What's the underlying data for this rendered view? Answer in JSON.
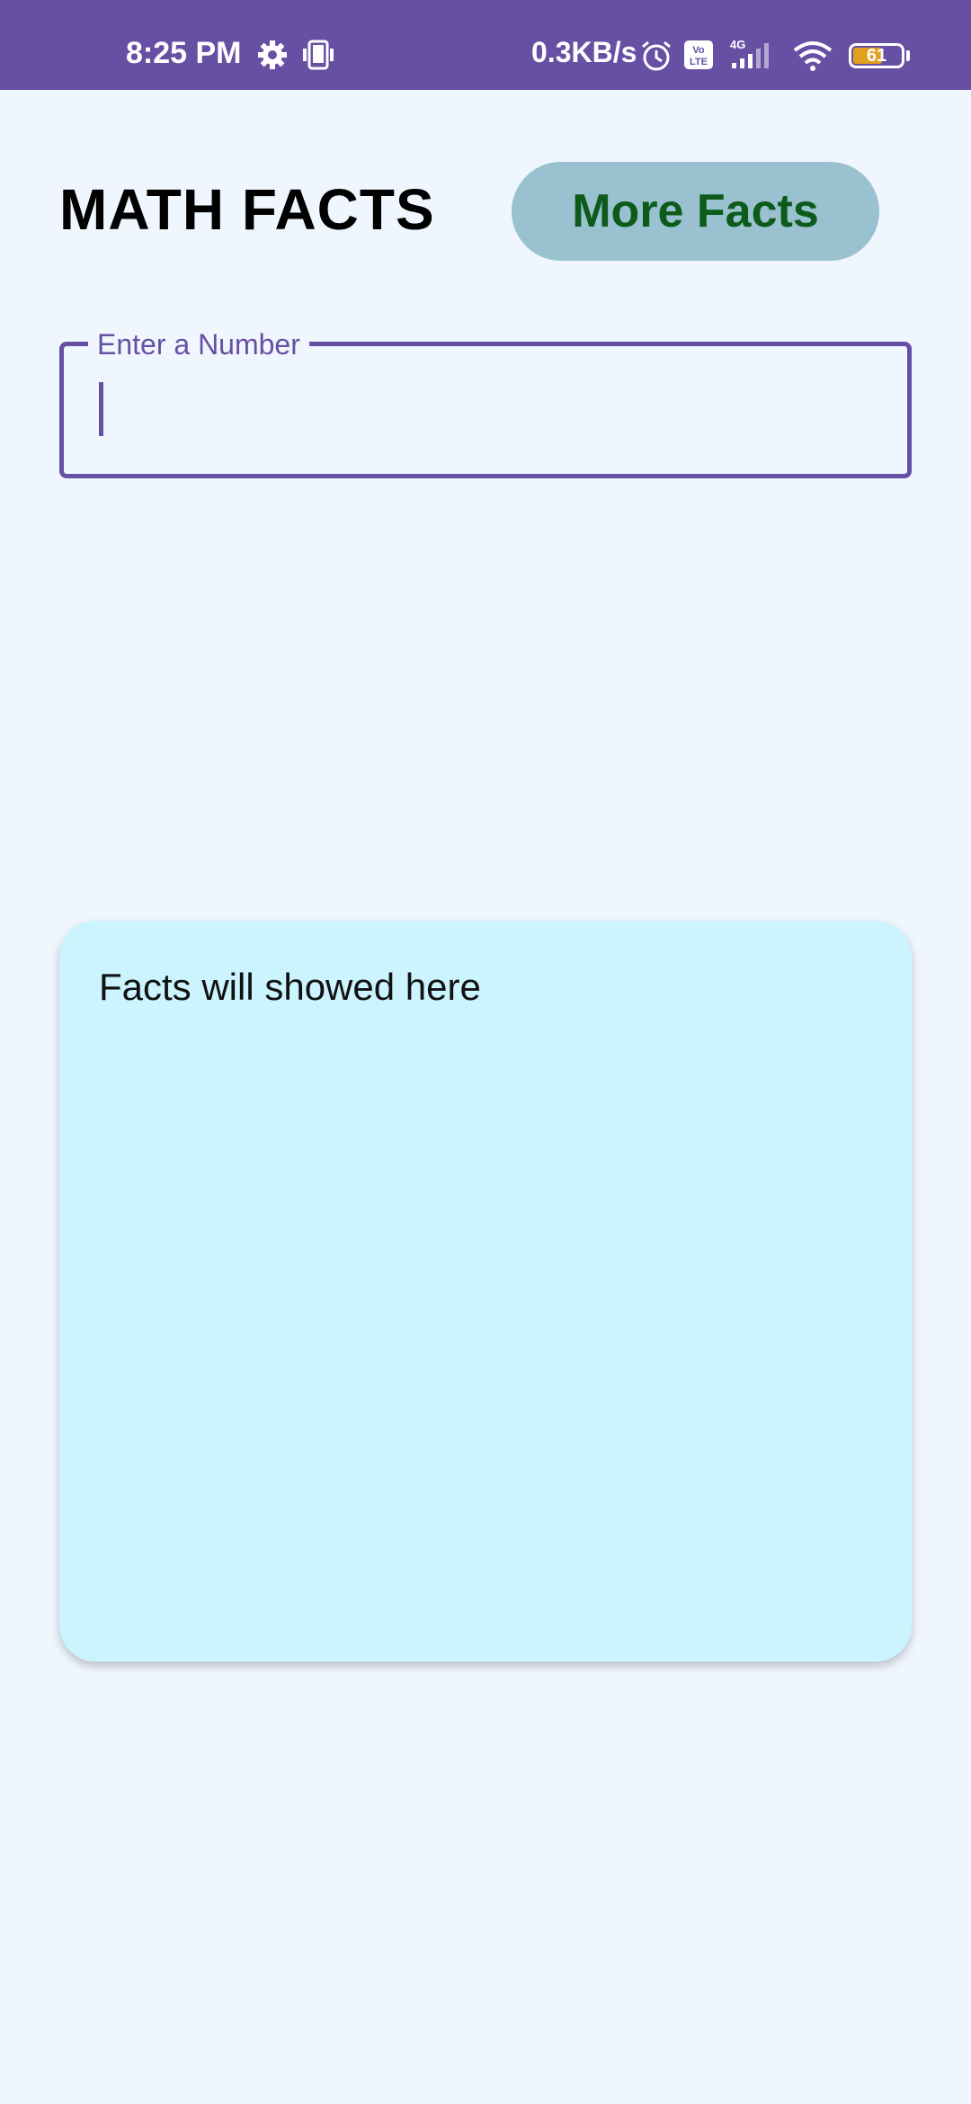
{
  "status_bar": {
    "time": "8:25 PM",
    "network_speed": "0.3KB/s",
    "battery_level": "61",
    "battery_fraction": 0.61,
    "icons": [
      "gear-icon",
      "phone-sync-icon",
      "alarm-icon",
      "volte-icon",
      "signal-4g-icon",
      "wifi-icon",
      "battery-icon"
    ],
    "background_color": "#6750a4"
  },
  "header": {
    "title": "MATH FACTS",
    "more_button_label": "More Facts",
    "button_color": "#99c1cf",
    "button_text_color": "#0d5b1a"
  },
  "number_input": {
    "label": "Enter a Number",
    "value": "",
    "accent_color": "#6750a4"
  },
  "facts_card": {
    "text": "Facts will showed here",
    "background_color": "#cbf4fe"
  },
  "page": {
    "background_color": "#f0f6fe"
  }
}
